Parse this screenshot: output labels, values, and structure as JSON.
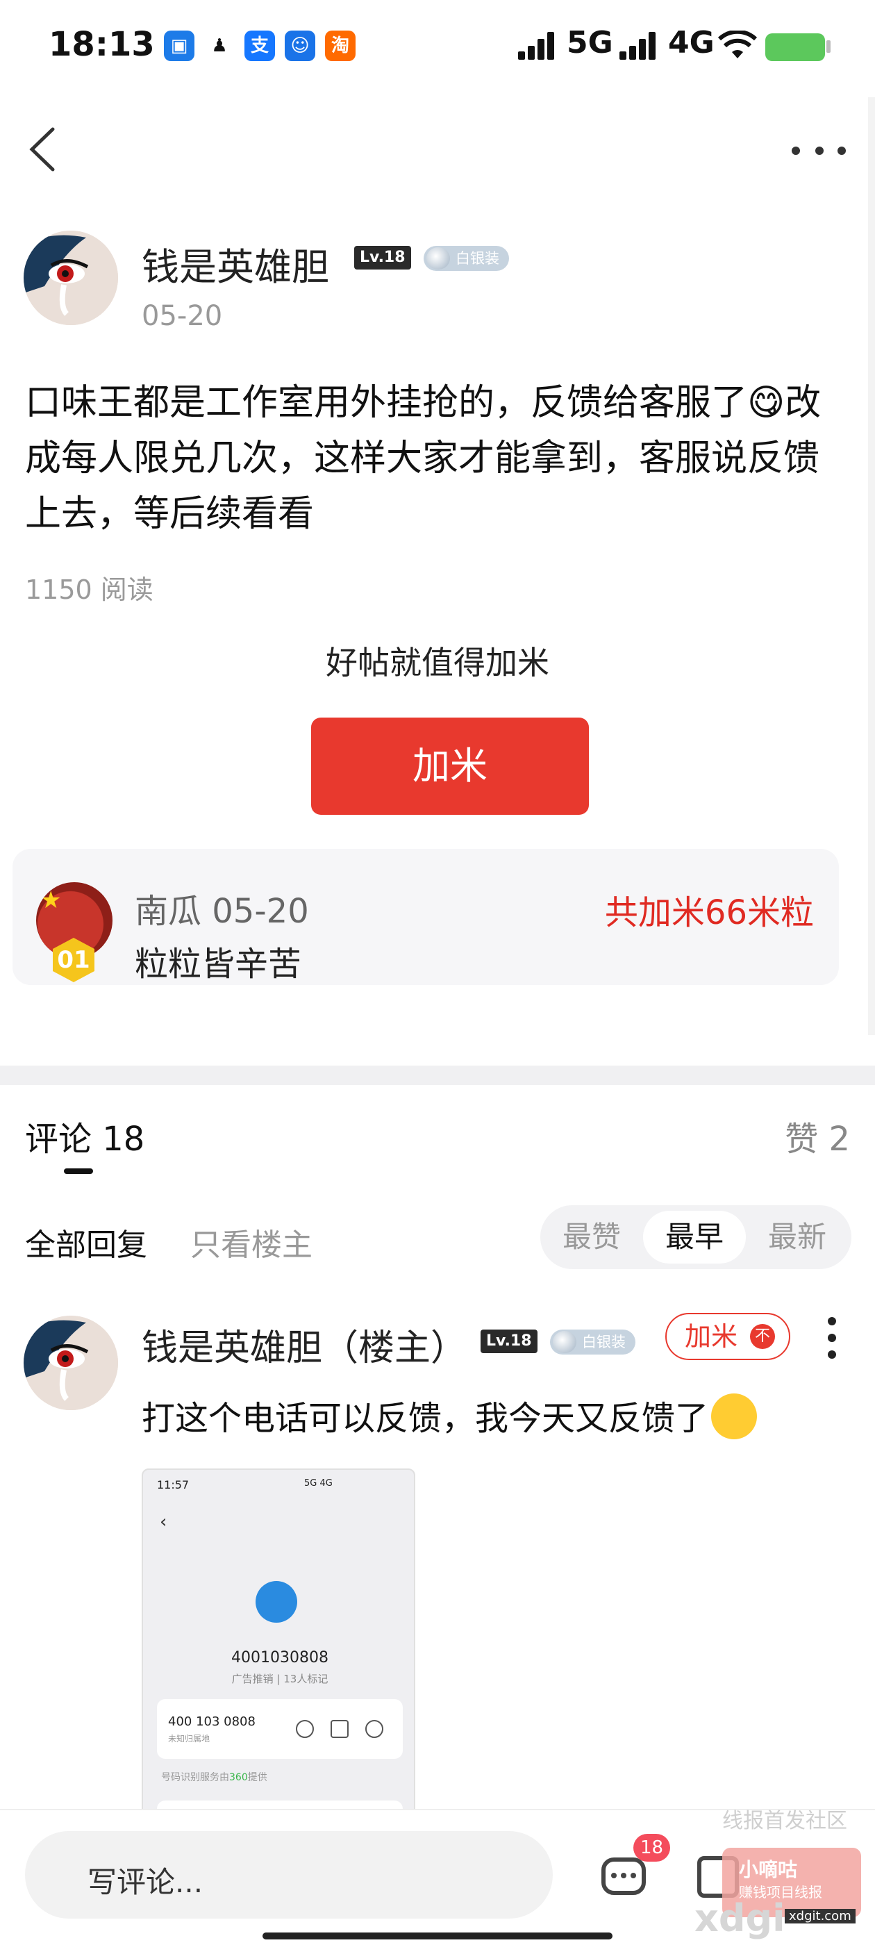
{
  "status_bar": {
    "time": "18:13",
    "apps": [
      "alipay-style-icon",
      "penguin-icon",
      "支",
      "search-bot-icon",
      "淘"
    ],
    "net1": "5G",
    "net2": "4G"
  },
  "post": {
    "author": "钱是英雄胆",
    "level": "Lv.18",
    "badge": "白银装",
    "date": "05-20",
    "text": "口味王都是工作室用外挂抢的，反馈给客服了😋改成每人限兑几次，这样大家才能拿到，客服说反馈上去，等后续看看",
    "reads": "1150 阅读",
    "tip": "好帖就值得加米",
    "jiami_button": "加米"
  },
  "reward": {
    "name_date": "南瓜 05-20",
    "message": "粒粒皆辛苦",
    "total": "共加米66米粒",
    "rank": "01"
  },
  "comments": {
    "tab_label": "评论 18",
    "likes": "赞 2",
    "filter_all": "全部回复",
    "filter_owner": "只看楼主",
    "sort_options": [
      "最赞",
      "最早",
      "最新"
    ],
    "sort_selected": "最早"
  },
  "first_comment": {
    "author": "钱是英雄胆（楼主）",
    "level": "Lv.18",
    "badge": "白银装",
    "jiami_label": "加米",
    "jiami_dot": "不",
    "text": "打这个电话可以反馈，我今天又反馈了"
  },
  "screenshot": {
    "time": "11:57",
    "status": "5G 4G",
    "number": "4001030808",
    "tag": "广告推销 | 13人标记",
    "card_number": "400 103 0808",
    "card_location": "未知归属地",
    "provider_prefix": "号码识别服务由",
    "provider_name": "360",
    "provider_suffix": "提供"
  },
  "bottom_bar": {
    "placeholder": "写评论...",
    "comment_count": "18",
    "watermark": "线报首发社区",
    "logo_title": "小嘀咕",
    "logo_sub": "赚钱项目线报",
    "logo_url": "xdgit.com",
    "logo_big": "xdgi"
  },
  "colors": {
    "accent": "#e8392e",
    "reward_total": "#e02a22",
    "battery": "#5cc85c"
  }
}
